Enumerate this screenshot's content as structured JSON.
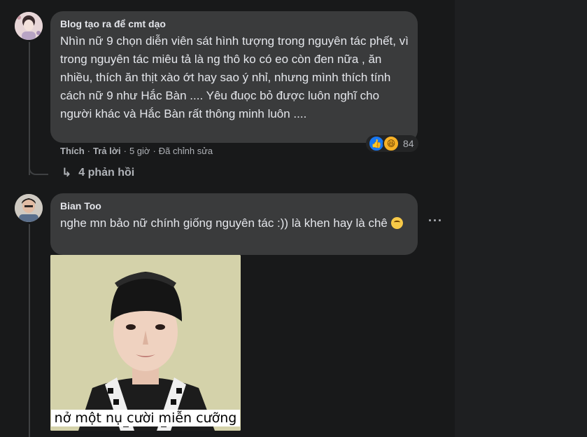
{
  "comment1": {
    "author": "Blog tạo ra để cmt dạo",
    "text": "Nhìn nữ 9 chọn diễn viên sát hình tượng trong nguyên tác phết, vì trong nguyên tác miêu tả là ng thô ko có eo còn đen nữa , ăn nhiều, thích ăn thịt xào ớt hay sao ý nhỉ, nhưng mình thích tính cách nữ 9 như Hắc Bàn .... Yêu đuọc bỏ được luôn nghĩ cho người khác và Hắc Bàn rất thông minh luôn ....",
    "actions": {
      "like": "Thích",
      "reply": "Trả lời",
      "time": "5 giờ",
      "edited": "Đã chỉnh sửa",
      "separator": "·"
    },
    "reactions": {
      "count": "84",
      "icons": [
        "like-icon",
        "haha-icon"
      ]
    },
    "replies_label": "4 phản hồi"
  },
  "comment2": {
    "author": "Bian Too",
    "text": "nghe mn bảo nữ chính giống nguyên tác :)) là khen hay là chê",
    "more_label": "···",
    "photo_caption": "nở một nụ cười miễn cưỡng"
  }
}
